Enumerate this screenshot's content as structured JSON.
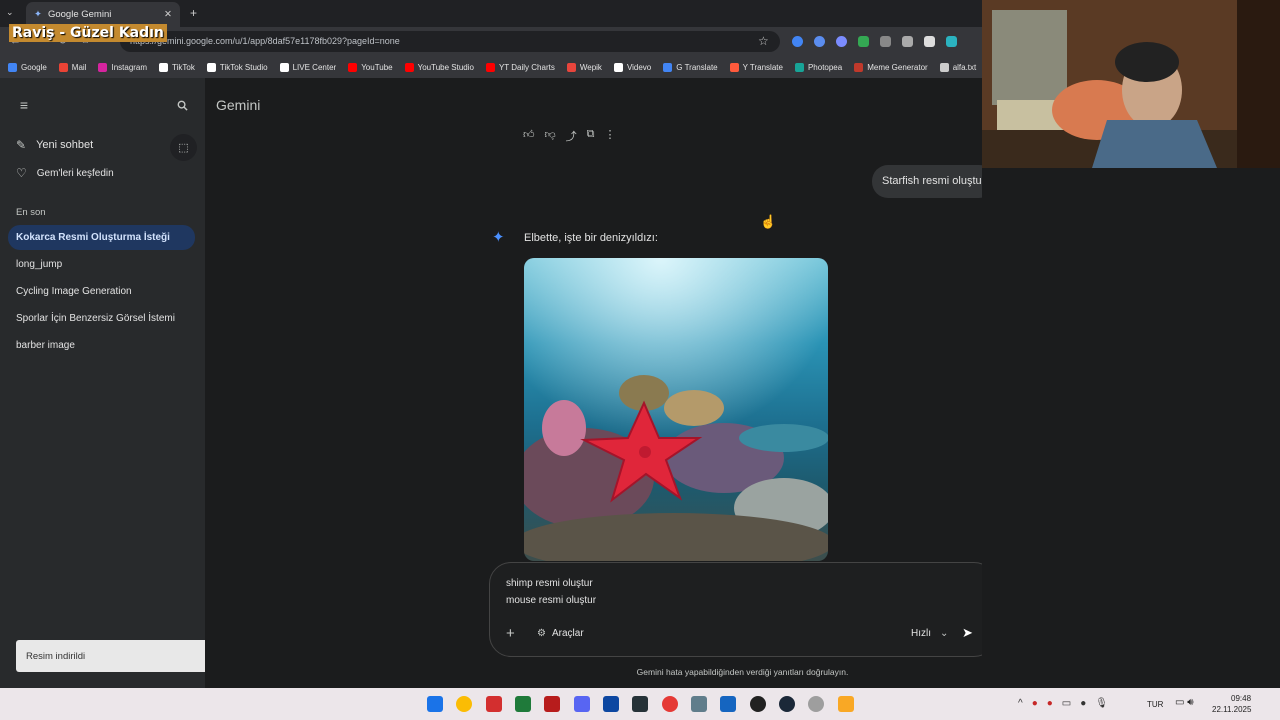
{
  "overlay_text": "Raviş - Güzel Kadın",
  "browser": {
    "tab_title": "Google Gemini",
    "url": "https://gemini.google.com/u/1/app/8daf57e1178fb029?pageId=none",
    "bookmarks": [
      {
        "label": "Google",
        "color": "#4285f4"
      },
      {
        "label": "Mail",
        "color": "#ea4335"
      },
      {
        "label": "Instagram",
        "color": "#d6249f"
      },
      {
        "label": "TikTok",
        "color": "#ffffff"
      },
      {
        "label": "TikTok Studio",
        "color": "#ffffff"
      },
      {
        "label": "LIVE Center",
        "color": "#ffffff"
      },
      {
        "label": "YouTube",
        "color": "#ff0000"
      },
      {
        "label": "YouTube Studio",
        "color": "#ff0000"
      },
      {
        "label": "YT Daily Charts",
        "color": "#ff0000"
      },
      {
        "label": "Wepik",
        "color": "#e8453c"
      },
      {
        "label": "Videvo",
        "color": "#ffffff"
      },
      {
        "label": "G Translate",
        "color": "#4285f4"
      },
      {
        "label": "Y Translate",
        "color": "#ff5a3c"
      },
      {
        "label": "Photopea",
        "color": "#18a497"
      },
      {
        "label": "Meme Generator",
        "color": "#c0392b"
      },
      {
        "label": "alfa.txt",
        "color": "#cccccc"
      }
    ]
  },
  "app": {
    "title": "Gemini"
  },
  "sidebar": {
    "new_chat": "Yeni sohbet",
    "explore_gems": "Gem'leri keşfedin",
    "recent_label": "En son",
    "items": [
      "Kokarca Resmi Oluşturma İsteği",
      "long_jump",
      "Cycling Image Generation",
      "Sporlar İçin Benzersiz Görsel İstemi",
      "barber image"
    ],
    "toast": "Resim indirildi"
  },
  "chat": {
    "user_message": "Starfish resmi oluştur",
    "model_reply": "Elbette, işte bir denizyıldızı:",
    "input_line1": "shimp resmi oluştur",
    "input_line2": "mouse resmi oluştur",
    "tools_label": "Araçlar",
    "mode_label": "Hızlı",
    "disclaimer": "Gemini hata yapabildiğinden verdiği yanıtları doğrulayın."
  },
  "taskbar": {
    "lang": "TUR",
    "time": "09:48",
    "date": "22.11.2025"
  },
  "colors": {
    "accent": "#4b90ff",
    "active_item": "#1f3760",
    "sidebar": "#282a2c",
    "main": "#1b1c1d"
  }
}
